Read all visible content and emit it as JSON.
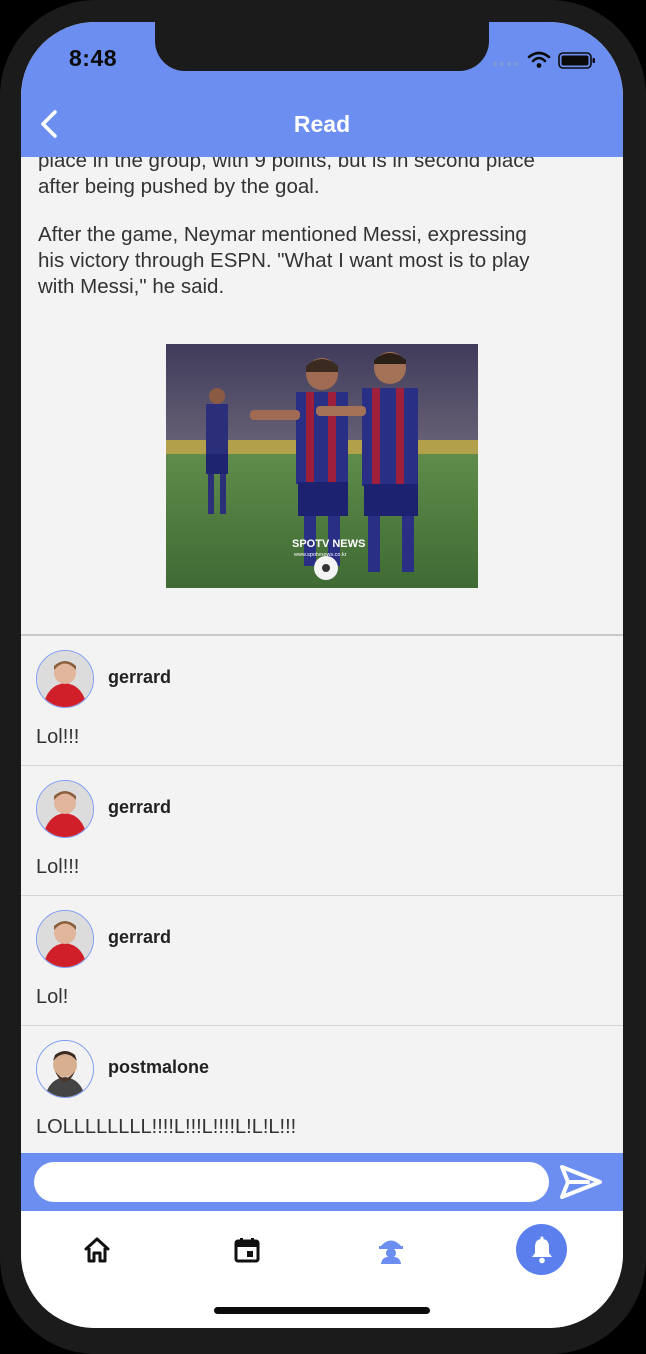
{
  "status": {
    "time": "8:48"
  },
  "header": {
    "title": "Read"
  },
  "article": {
    "para_partial_top": "place in the group, with 9 points, but is in second place",
    "para_partial_bottom": "after being pushed by the goal.",
    "para2_line1": "After the game, Neymar mentioned Messi, expressing",
    "para2_line2": "his victory through ESPN. \"What I want most is to play",
    "para2_line3": "with Messi,\" he said.",
    "image_watermark": "SPOTV NEWS",
    "image_watermark_sub": "www.spotvnews.co.kr"
  },
  "comments": [
    {
      "user": "gerrard",
      "text": "Lol!!!",
      "avatar": "gerrard-avatar"
    },
    {
      "user": "gerrard",
      "text": "Lol!!!",
      "avatar": "gerrard-avatar"
    },
    {
      "user": "gerrard",
      "text": "Lol!",
      "avatar": "gerrard-avatar"
    },
    {
      "user": "postmalone",
      "text": "LOLLLLLLLL!!!!L!!!L!!!!L!L!L!!!",
      "avatar": "postmalone-avatar"
    }
  ],
  "composer": {
    "value": "",
    "placeholder": ""
  },
  "tabs": [
    {
      "icon": "home-icon"
    },
    {
      "icon": "calendar-icon"
    },
    {
      "icon": "community-icon"
    },
    {
      "icon": "bell-icon",
      "active": true
    }
  ],
  "colors": {
    "accent": "#6b8ef0",
    "active_tab": "#5b80ee",
    "background": "#f3f3f3"
  }
}
